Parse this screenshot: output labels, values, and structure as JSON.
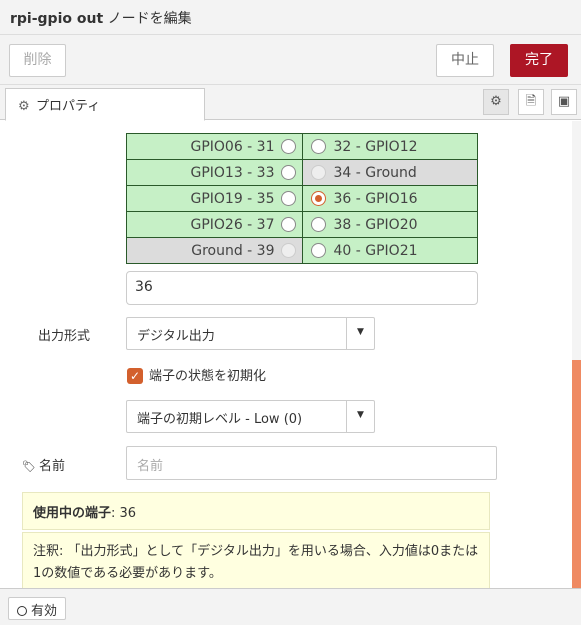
{
  "title": {
    "node": "rpi-gpio out",
    "suffix": " ノードを編集"
  },
  "toolbar": {
    "delete": "削除",
    "cancel": "中止",
    "done": "完了"
  },
  "tabs": {
    "properties": "プロパティ"
  },
  "pins": [
    {
      "left": "GPIO06 - 31",
      "left_state": "enabled",
      "left_bg": "green",
      "right": "32 - GPIO12",
      "right_state": "enabled",
      "right_bg": "green"
    },
    {
      "left": "GPIO13 - 33",
      "left_state": "enabled",
      "left_bg": "green",
      "right": "34 - Ground",
      "right_state": "disabled",
      "right_bg": "gray"
    },
    {
      "left": "GPIO19 - 35",
      "left_state": "enabled",
      "left_bg": "green",
      "right": "36 - GPIO16",
      "right_state": "selected",
      "right_bg": "green"
    },
    {
      "left": "GPIO26 - 37",
      "left_state": "enabled",
      "left_bg": "green",
      "right": "38 - GPIO20",
      "right_state": "enabled",
      "right_bg": "green"
    },
    {
      "left": "Ground - 39",
      "left_state": "disabled",
      "left_bg": "gray",
      "right": "40 - GPIO21",
      "right_state": "enabled",
      "right_bg": "green"
    }
  ],
  "pin_value": "36",
  "output_type": {
    "label": "出力形式",
    "value": "デジタル出力"
  },
  "init_state": {
    "label": "端子の状態を初期化",
    "checked": true
  },
  "init_level": {
    "value": "端子の初期レベル - Low (0)"
  },
  "name": {
    "label": "名前",
    "placeholder": "名前"
  },
  "pins_in_use": {
    "label": "使用中の端子",
    "value": ": 36"
  },
  "note": "注釈: 「出力形式」として「デジタル出力」を用いる場合、入力値は0または1の数値である必要があります。",
  "footer": {
    "enabled": "有効"
  },
  "colors": {
    "accent": "#ad1625",
    "radio": "#d3602d",
    "pin_green": "#c6f0c6",
    "pin_gray": "#dcdcdc"
  }
}
